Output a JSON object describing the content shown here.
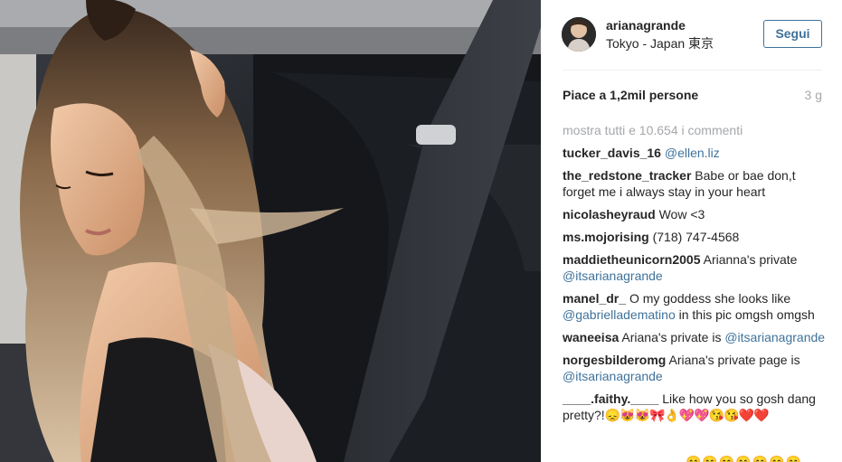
{
  "post": {
    "photo_alt": "",
    "username": "arianagrande",
    "location": "Tokyo - Japan 東京",
    "follow_label": "Segui",
    "likes": "Piace a 1,2mil persone",
    "time": "3 g",
    "show_all_comments": "mostra tutti e 10.654 i commenti"
  },
  "comments": [
    {
      "user": "tucker_davis_16",
      "pre": "",
      "mention": "@ellen.liz",
      "post": ""
    },
    {
      "user": "the_redstone_tracker",
      "pre": "Babe or bae don,t forget me i always stay in your heart",
      "mention": "",
      "post": ""
    },
    {
      "user": "nicolasheyraud",
      "pre": "Wow <3",
      "mention": "",
      "post": ""
    },
    {
      "user": "ms.mojorising",
      "pre": "(718) 747-4568",
      "mention": "",
      "post": ""
    },
    {
      "user": "maddietheunicorn2005",
      "pre": "Arianna's private",
      "mention": "@itsarianagrande",
      "post": ""
    },
    {
      "user": "manel_dr_",
      "pre": "O my goddess she looks like",
      "mention": "@gabrielladematino",
      "post": "in this pic omgsh omgsh"
    },
    {
      "user": "waneeisa",
      "pre": "Ariana's private is",
      "mention": "@itsarianagrande",
      "post": ""
    },
    {
      "user": "norgesbilderomg",
      "pre": "Ariana's private page is",
      "mention": "@itsarianagrande",
      "post": ""
    },
    {
      "user": "____.faithy.____",
      "pre": "Like how you so gosh dang pretty?!",
      "mention": "",
      "post": "",
      "emoji": "😞😻😻🎀👌💖💖😘😘❤️❤️"
    }
  ],
  "bottom_emojis": "😊😊😊😊😊😊😊",
  "colors": {
    "link": "#3f729b",
    "muted": "#a5a7aa",
    "text": "#262626"
  }
}
